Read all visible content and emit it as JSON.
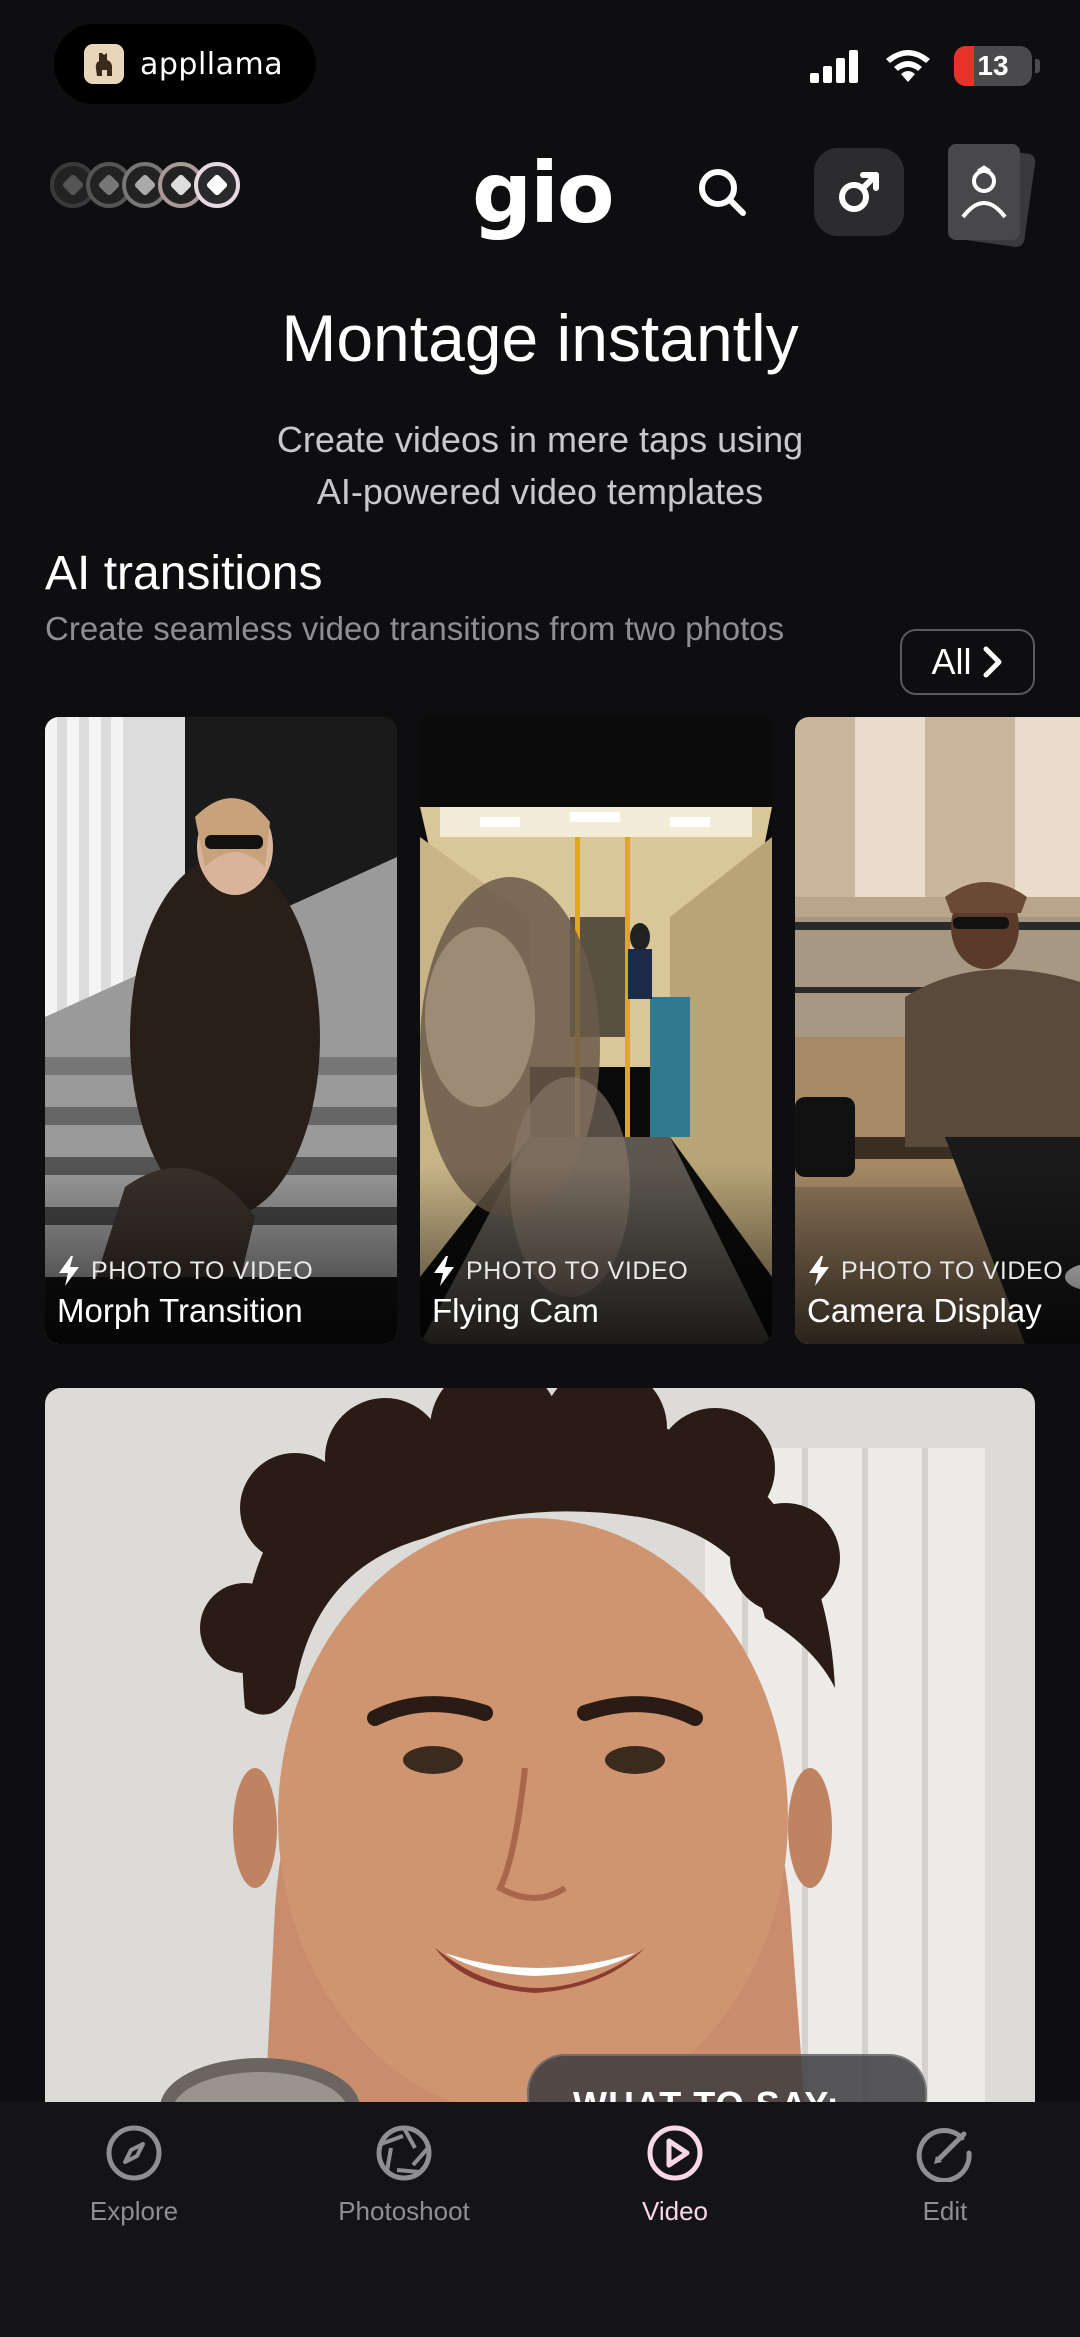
{
  "status_bar": {
    "overlay_app_name": "appllama",
    "battery_level": "13",
    "battery_fraction": 0.13
  },
  "header": {
    "brand": "gio",
    "icons": [
      "avatar-stack-icon",
      "search-icon",
      "male-gender-icon",
      "profile-icon"
    ]
  },
  "hero": {
    "title": "Montage instantly",
    "subtitle_line1": "Create videos in mere taps using",
    "subtitle_line2": "AI-powered video templates"
  },
  "section": {
    "title": "AI transitions",
    "subtitle": "Create seamless video transitions from two photos",
    "all_label": "All"
  },
  "cards": [
    {
      "tag": "PHOTO TO VIDEO",
      "name": "Morph Transition"
    },
    {
      "tag": "PHOTO TO VIDEO",
      "name": "Flying Cam"
    },
    {
      "tag": "PHOTO TO VIDEO",
      "name": "Camera Display"
    }
  ],
  "feature": {
    "overlay_text": "WHAT TO SAY:"
  },
  "tabs": [
    {
      "label": "Explore",
      "icon": "compass-icon",
      "active": false
    },
    {
      "label": "Photoshoot",
      "icon": "aperture-icon",
      "active": false
    },
    {
      "label": "Video",
      "icon": "play-circle-icon",
      "active": true
    },
    {
      "label": "Edit",
      "icon": "edit-circle-icon",
      "active": false
    }
  ],
  "colors": {
    "background": "#0e0e10",
    "active_tab": "#f8d7e6",
    "inactive_tab": "#8e8e93",
    "battery_low": "#e5332a"
  }
}
